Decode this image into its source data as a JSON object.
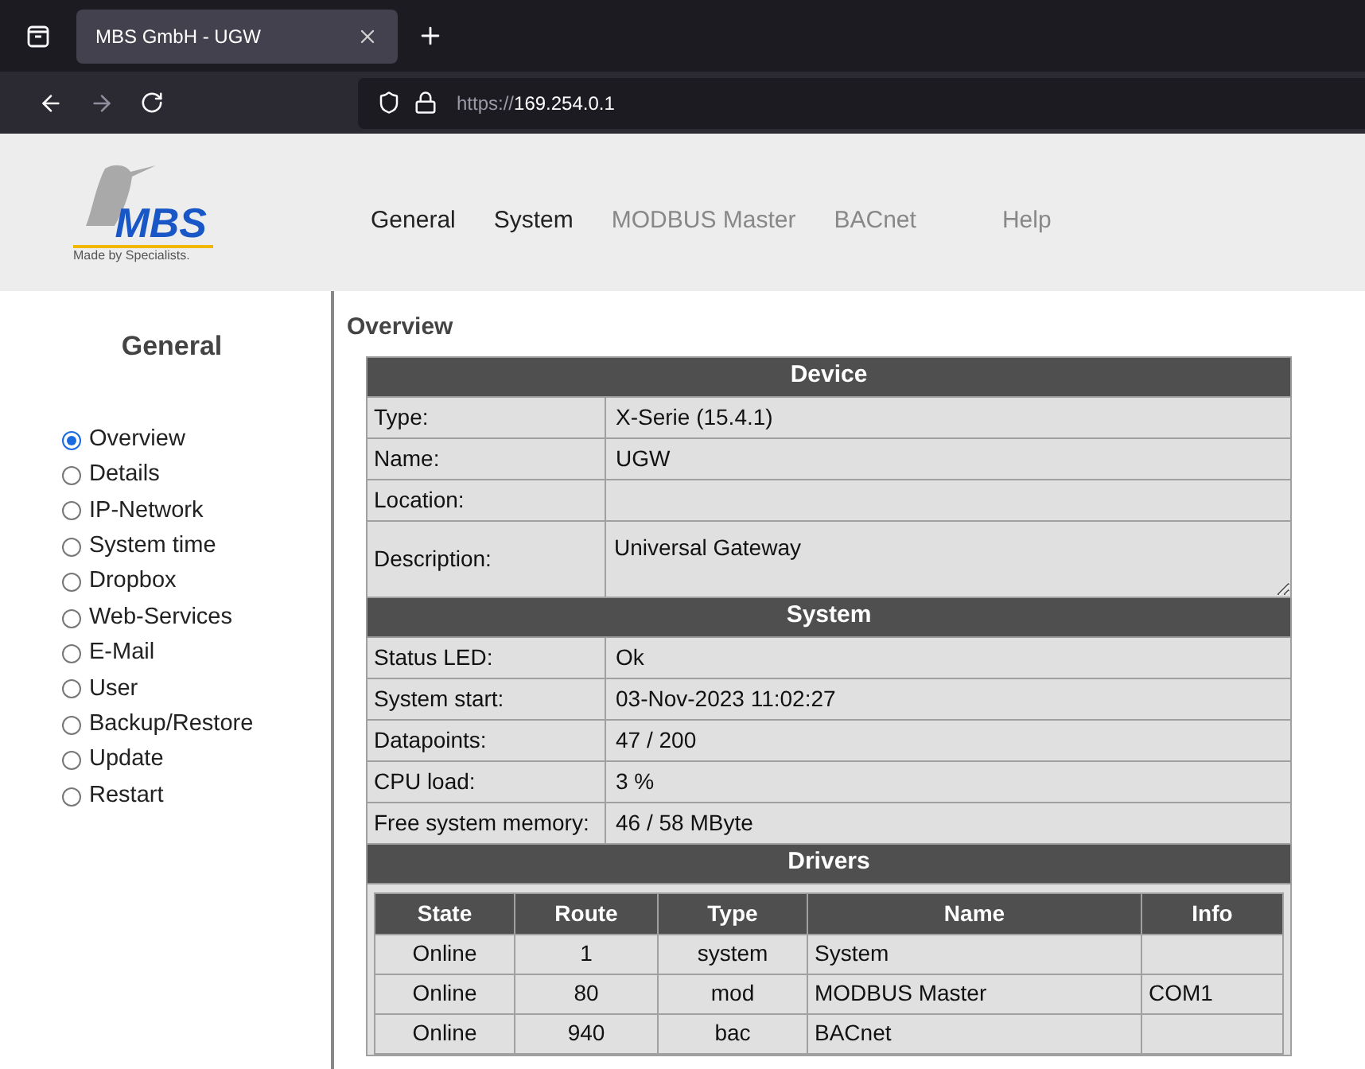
{
  "browser": {
    "tab_title": "MBS GmbH - UGW",
    "url_prefix": "https://",
    "url_host": "169.254.0.1"
  },
  "header": {
    "logo_text": "MBS",
    "logo_tagline": "Made by Specialists.",
    "nav": [
      {
        "label": "General",
        "disabled": false
      },
      {
        "label": "System",
        "disabled": false
      },
      {
        "label": "MODBUS Master",
        "disabled": true
      },
      {
        "label": "BACnet",
        "disabled": true
      },
      {
        "label": "Help",
        "disabled": true
      }
    ]
  },
  "sidebar": {
    "title": "General",
    "items": [
      {
        "label": "Overview",
        "selected": true
      },
      {
        "label": "Details",
        "selected": false
      },
      {
        "label": "IP-Network",
        "selected": false
      },
      {
        "label": "System time",
        "selected": false
      },
      {
        "label": "Dropbox",
        "selected": false
      },
      {
        "label": "Web-Services",
        "selected": false
      },
      {
        "label": "E-Mail",
        "selected": false
      },
      {
        "label": "User",
        "selected": false
      },
      {
        "label": "Backup/Restore",
        "selected": false
      },
      {
        "label": "Update",
        "selected": false
      },
      {
        "label": "Restart",
        "selected": false
      }
    ]
  },
  "content": {
    "title": "Overview",
    "device": {
      "heading": "Device",
      "rows": [
        {
          "label": "Type:",
          "value": "X-Serie (15.4.1)",
          "kind": "text"
        },
        {
          "label": "Name:",
          "value": "UGW",
          "kind": "text"
        },
        {
          "label": "Location:",
          "kind": "text"
        },
        {
          "label": "Description:",
          "value": "Universal Gateway",
          "kind": "textarea"
        }
      ]
    },
    "system": {
      "heading": "System",
      "rows": [
        {
          "label": "Status LED:",
          "value": "Ok"
        },
        {
          "label": "System start:",
          "value": "03-Nov-2023 11:02:27"
        },
        {
          "label": "Datapoints:",
          "value": "47 / 200"
        },
        {
          "label": "CPU load:",
          "value": "3 %"
        },
        {
          "label": "Free system memory:",
          "value": "46 / 58 MByte"
        }
      ]
    },
    "drivers": {
      "heading": "Drivers",
      "columns": [
        "State",
        "Route",
        "Type",
        "Name",
        "Info"
      ],
      "rows": [
        [
          "Online",
          "1",
          "system",
          "System",
          ""
        ],
        [
          "Online",
          "80",
          "mod",
          "MODBUS Master",
          "COM1"
        ],
        [
          "Online",
          "940",
          "bac",
          "BACnet",
          ""
        ]
      ]
    }
  }
}
